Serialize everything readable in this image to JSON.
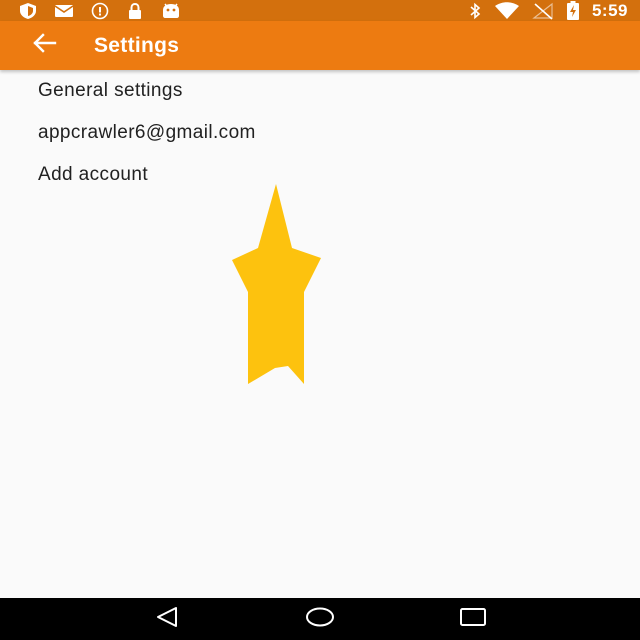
{
  "status_bar": {
    "time": "5:59",
    "left_icons": [
      "shield-icon",
      "email-icon",
      "alert-icon",
      "lock-icon",
      "android-icon"
    ],
    "right_icons": [
      "bluetooth-icon",
      "wifi-icon",
      "no-signal-icon",
      "battery-charging-icon"
    ]
  },
  "toolbar": {
    "title": "Settings",
    "back_icon": "arrow-left-icon"
  },
  "settings": {
    "items": [
      {
        "label": "General settings"
      },
      {
        "label": "appcrawler6@gmail.com"
      },
      {
        "label": "Add account"
      }
    ]
  },
  "nav_bar": {
    "buttons": [
      "back-triangle-icon",
      "home-circle-icon",
      "recents-square-icon"
    ]
  },
  "colors": {
    "status_bar": "#d3700d",
    "toolbar": "#ed7b11",
    "background": "#fafafa",
    "text": "#212121",
    "star": "#fdc20e",
    "nav_bar": "#000000"
  }
}
